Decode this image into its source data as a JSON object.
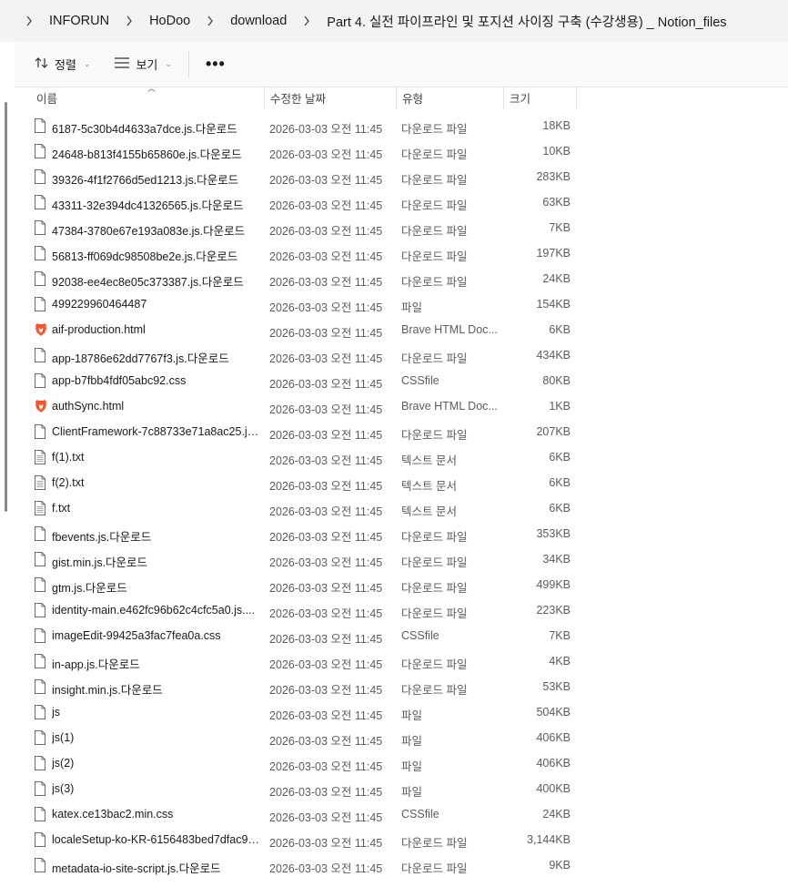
{
  "breadcrumb": [
    "INFORUN",
    "HoDoo",
    "download",
    "Part 4. 실전 파이프라인 및 포지션 사이징 구축 (수강생용) _ Notion_files"
  ],
  "toolbar": {
    "sort_label": "정렬",
    "view_label": "보기",
    "more_label": "•••"
  },
  "columns": {
    "name": "이름",
    "modified": "수정한 날짜",
    "type": "유형",
    "size": "크기"
  },
  "files": [
    {
      "name": "6187-5c30b4d4633a7dce.js.다운로드",
      "date": "2026-03-03 오전 11:45",
      "type": "다운로드 파일",
      "size": "18KB",
      "icon": "file-icon"
    },
    {
      "name": "24648-b813f4155b65860e.js.다운로드",
      "date": "2026-03-03 오전 11:45",
      "type": "다운로드 파일",
      "size": "10KB",
      "icon": "file-icon"
    },
    {
      "name": "39326-4f1f2766d5ed1213.js.다운로드",
      "date": "2026-03-03 오전 11:45",
      "type": "다운로드 파일",
      "size": "283KB",
      "icon": "file-icon"
    },
    {
      "name": "43311-32e394dc41326565.js.다운로드",
      "date": "2026-03-03 오전 11:45",
      "type": "다운로드 파일",
      "size": "63KB",
      "icon": "file-icon"
    },
    {
      "name": "47384-3780e67e193a083e.js.다운로드",
      "date": "2026-03-03 오전 11:45",
      "type": "다운로드 파일",
      "size": "7KB",
      "icon": "file-icon"
    },
    {
      "name": "56813-ff069dc98508be2e.js.다운로드",
      "date": "2026-03-03 오전 11:45",
      "type": "다운로드 파일",
      "size": "197KB",
      "icon": "file-icon"
    },
    {
      "name": "92038-ee4ec8e05c373387.js.다운로드",
      "date": "2026-03-03 오전 11:45",
      "type": "다운로드 파일",
      "size": "24KB",
      "icon": "file-icon"
    },
    {
      "name": "499229960464487",
      "date": "2026-03-03 오전 11:45",
      "type": "파일",
      "size": "154KB",
      "icon": "file-icon"
    },
    {
      "name": "aif-production.html",
      "date": "2026-03-03 오전 11:45",
      "type": "Brave HTML Doc...",
      "size": "6KB",
      "icon": "brave-icon"
    },
    {
      "name": "app-18786e62dd7767f3.js.다운로드",
      "date": "2026-03-03 오전 11:45",
      "type": "다운로드 파일",
      "size": "434KB",
      "icon": "file-icon"
    },
    {
      "name": "app-b7fbb4fdf05abc92.css",
      "date": "2026-03-03 오전 11:45",
      "type": "CSSfile",
      "size": "80KB",
      "icon": "file-icon"
    },
    {
      "name": "authSync.html",
      "date": "2026-03-03 오전 11:45",
      "type": "Brave HTML Doc...",
      "size": "1KB",
      "icon": "brave-icon"
    },
    {
      "name": "ClientFramework-7c88733e71a8ac25.js....",
      "date": "2026-03-03 오전 11:45",
      "type": "다운로드 파일",
      "size": "207KB",
      "icon": "file-icon"
    },
    {
      "name": "f(1).txt",
      "date": "2026-03-03 오전 11:45",
      "type": "텍스트 문서",
      "size": "6KB",
      "icon": "text-file-icon"
    },
    {
      "name": "f(2).txt",
      "date": "2026-03-03 오전 11:45",
      "type": "텍스트 문서",
      "size": "6KB",
      "icon": "text-file-icon"
    },
    {
      "name": "f.txt",
      "date": "2026-03-03 오전 11:45",
      "type": "텍스트 문서",
      "size": "6KB",
      "icon": "text-file-icon"
    },
    {
      "name": "fbevents.js.다운로드",
      "date": "2026-03-03 오전 11:45",
      "type": "다운로드 파일",
      "size": "353KB",
      "icon": "file-icon"
    },
    {
      "name": "gist.min.js.다운로드",
      "date": "2026-03-03 오전 11:45",
      "type": "다운로드 파일",
      "size": "34KB",
      "icon": "file-icon"
    },
    {
      "name": "gtm.js.다운로드",
      "date": "2026-03-03 오전 11:45",
      "type": "다운로드 파일",
      "size": "499KB",
      "icon": "file-icon"
    },
    {
      "name": "identity-main.e462fc96b62c4cfc5a0.js....",
      "date": "2026-03-03 오전 11:45",
      "type": "다운로드 파일",
      "size": "223KB",
      "icon": "file-icon"
    },
    {
      "name": "imageEdit-99425a3fac7fea0a.css",
      "date": "2026-03-03 오전 11:45",
      "type": "CSSfile",
      "size": "7KB",
      "icon": "file-icon"
    },
    {
      "name": "in-app.js.다운로드",
      "date": "2026-03-03 오전 11:45",
      "type": "다운로드 파일",
      "size": "4KB",
      "icon": "file-icon"
    },
    {
      "name": "insight.min.js.다운로드",
      "date": "2026-03-03 오전 11:45",
      "type": "다운로드 파일",
      "size": "53KB",
      "icon": "file-icon"
    },
    {
      "name": "js",
      "date": "2026-03-03 오전 11:45",
      "type": "파일",
      "size": "504KB",
      "icon": "file-icon"
    },
    {
      "name": "js(1)",
      "date": "2026-03-03 오전 11:45",
      "type": "파일",
      "size": "406KB",
      "icon": "file-icon"
    },
    {
      "name": "js(2)",
      "date": "2026-03-03 오전 11:45",
      "type": "파일",
      "size": "406KB",
      "icon": "file-icon"
    },
    {
      "name": "js(3)",
      "date": "2026-03-03 오전 11:45",
      "type": "파일",
      "size": "400KB",
      "icon": "file-icon"
    },
    {
      "name": "katex.ce13bac2.min.css",
      "date": "2026-03-03 오전 11:45",
      "type": "CSSfile",
      "size": "24KB",
      "icon": "file-icon"
    },
    {
      "name": "localeSetup-ko-KR-6156483bed7dfac99...",
      "date": "2026-03-03 오전 11:45",
      "type": "다운로드 파일",
      "size": "3,144KB",
      "icon": "file-icon"
    },
    {
      "name": "metadata-io-site-script.js.다운로드",
      "date": "2026-03-03 오전 11:45",
      "type": "다운로드 파일",
      "size": "9KB",
      "icon": "file-icon"
    }
  ]
}
